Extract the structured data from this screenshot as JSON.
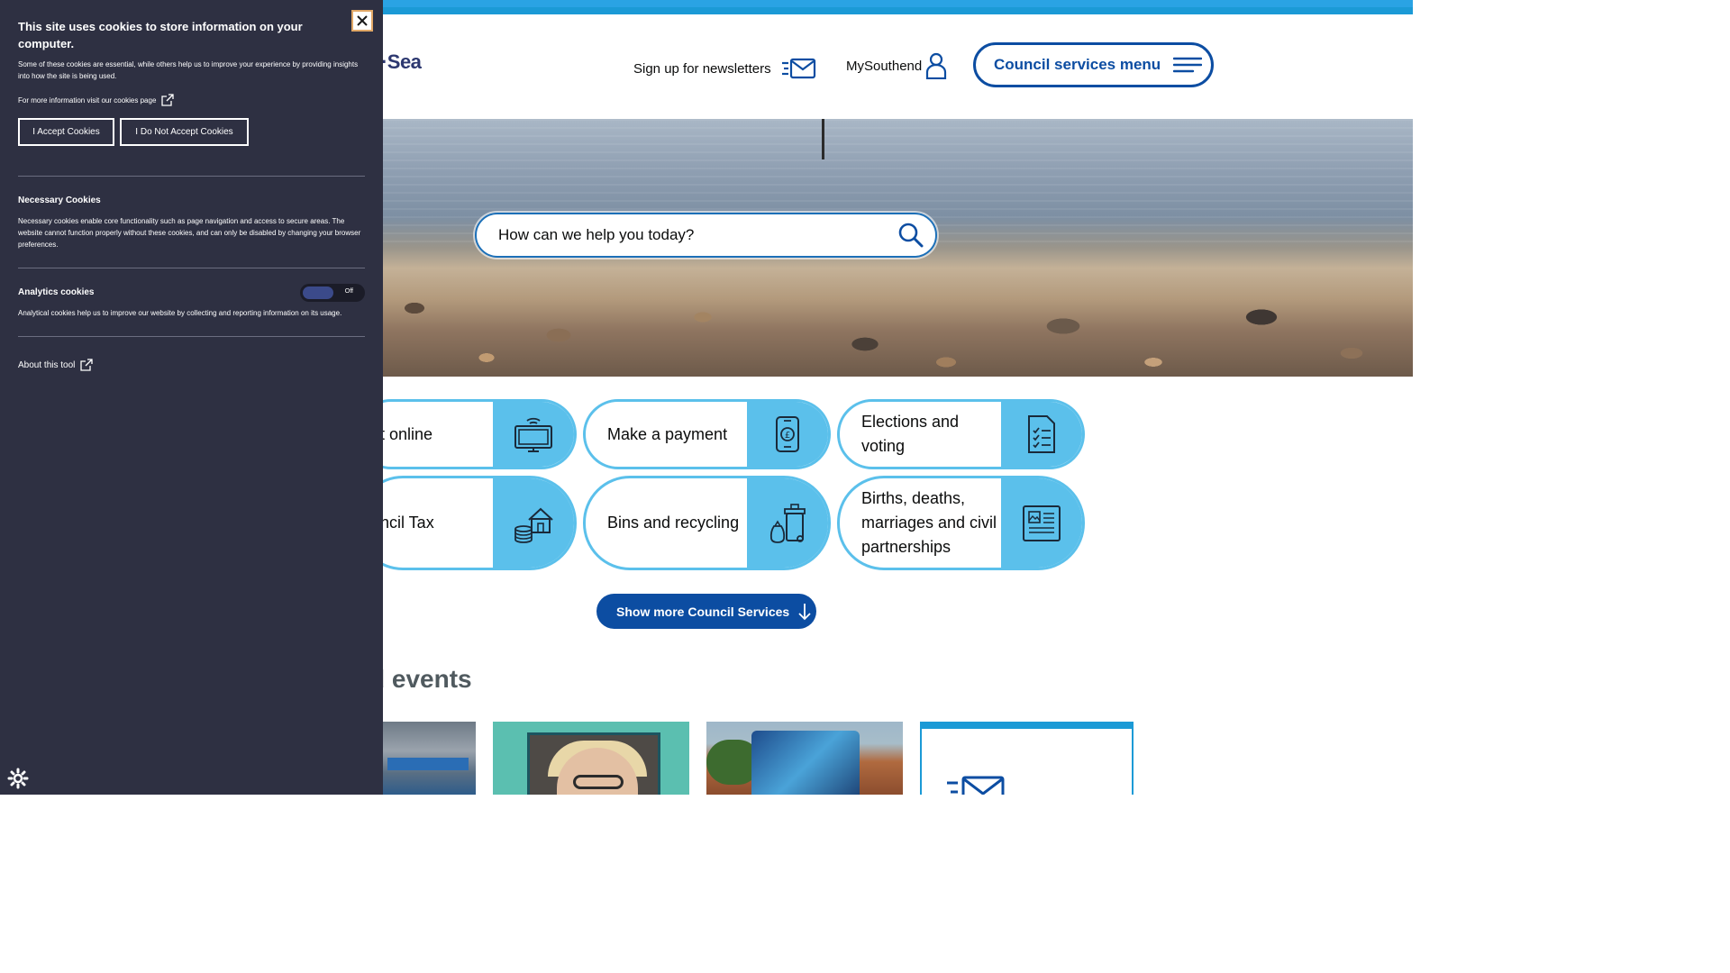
{
  "header": {
    "logo_fragment": "n·Sea",
    "newsletter_label": "Sign up for newsletters",
    "mysouthend_label": "MySouthend",
    "services_menu_label": "Council services menu"
  },
  "search": {
    "placeholder": "How can we help you today?"
  },
  "tiles": [
    {
      "label": "t online",
      "icon": "computer-icon"
    },
    {
      "label": "Make a payment",
      "icon": "phone-payment-icon"
    },
    {
      "label": "Elections and voting",
      "icon": "checklist-icon"
    },
    {
      "label": "ncil Tax",
      "icon": "house-coins-icon"
    },
    {
      "label": "Bins and recycling",
      "icon": "bins-icon"
    },
    {
      "label": "Births, deaths, marriages and civil partnerships",
      "icon": "document-icon"
    }
  ],
  "show_more_label": "Show more Council Services",
  "section_title": "d events",
  "cookies": {
    "title": "This site uses cookies to store information on your computer.",
    "intro": "Some of these cookies are essential, while others help us to improve your experience by providing insights into how the site is being used.",
    "more_info": "For more information visit our cookies page",
    "accept_label": "I Accept Cookies",
    "decline_label": "I Do Not Accept Cookies",
    "necessary_heading": "Necessary Cookies",
    "necessary_text": "Necessary cookies enable core functionality such as page navigation and access to secure areas. The website cannot function properly without these cookies, and can only be disabled by changing your browser preferences.",
    "analytics_heading": "Analytics cookies",
    "analytics_state": "Off",
    "analytics_text": "Analytical cookies help us to improve our website by collecting and reporting information on its usage.",
    "about_label": "About this tool"
  },
  "colors": {
    "brand_blue": "#0c4da2",
    "tile_accent": "#5bc0eb",
    "cookie_bg": "#2e3042"
  }
}
